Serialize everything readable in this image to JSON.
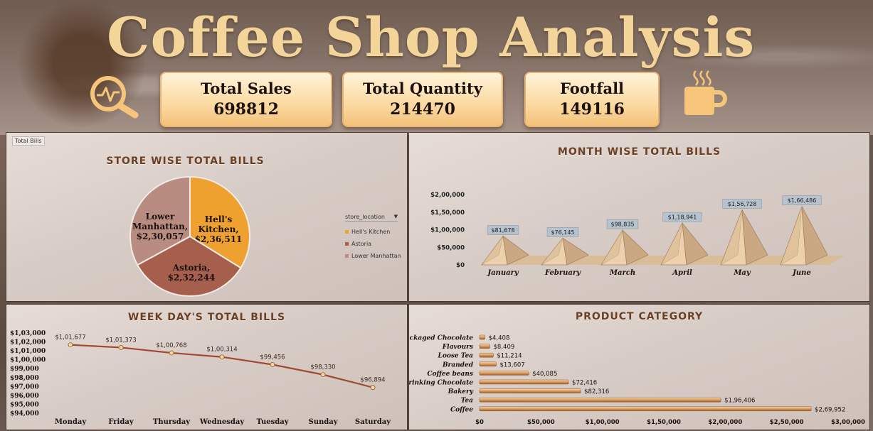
{
  "header": {
    "title": "Coffee Shop Analysis",
    "kpis": [
      {
        "label": "Total Sales",
        "value": "698812"
      },
      {
        "label": "Total Quantity",
        "value": "214470"
      },
      {
        "label": "Footfall",
        "value": "149116"
      }
    ]
  },
  "icons": {
    "left": "analytics-magnifier-icon",
    "right": "coffee-cup-icon"
  },
  "colors": {
    "title": "#f3d59a",
    "hells_kitchen": "#eea12f",
    "astoria": "#a65f4d",
    "lower_manhattan": "#b88c80",
    "accent_text": "#6b3f22",
    "line": "#a04a32"
  },
  "store_panel": {
    "chip": "Total Bills",
    "filter_label": "store_location"
  },
  "month_panel": {
    "title": "MONTH WISE TOTAL BILLS"
  },
  "week_panel": {
    "title": "WEEK DAY'S TOTAL BILLS"
  },
  "product_panel": {
    "title": "PRODUCT CATEGORY"
  },
  "chart_data": [
    {
      "type": "pie",
      "title": "STORE WISE TOTAL BILLS",
      "legend_position": "right",
      "slices": [
        {
          "name": "Hell's Kitchen",
          "label_lines": [
            "Hell's",
            "Kitchen,",
            "$2,36,511"
          ],
          "value": 236511,
          "color": "#eea12f"
        },
        {
          "name": "Astoria",
          "label_lines": [
            "Astoria,",
            "$2,32,244"
          ],
          "value": 232244,
          "color": "#a65f4d"
        },
        {
          "name": "Lower Manhattan",
          "label_lines": [
            "Lower",
            "Manhattan,",
            "$2,30,057"
          ],
          "value": 230057,
          "color": "#b88c80"
        }
      ],
      "legend": [
        "Hell's Kitchen",
        "Astoria",
        "Lower Manhattan"
      ]
    },
    {
      "type": "bar",
      "shape": "pyramid",
      "title": "MONTH WISE TOTAL BILLS",
      "categories": [
        "January",
        "February",
        "March",
        "April",
        "May",
        "June"
      ],
      "values": [
        81678,
        76145,
        98835,
        118941,
        156728,
        166486
      ],
      "data_labels": [
        "$81,678",
        "$76,145",
        "$98,835",
        "$1,18,941",
        "$1,56,728",
        "$1,66,486"
      ],
      "yticks": [
        0,
        50000,
        100000,
        150000,
        200000
      ],
      "ytick_labels": [
        "$0",
        "$50,000",
        "$1,00,000",
        "$1,50,000",
        "$2,00,000"
      ],
      "ylim": [
        0,
        200000
      ]
    },
    {
      "type": "line",
      "title": "WEEK DAY'S TOTAL BILLS",
      "categories": [
        "Monday",
        "Friday",
        "Thursday",
        "Wednesday",
        "Tuesday",
        "Sunday",
        "Saturday"
      ],
      "values": [
        101677,
        101373,
        100768,
        100314,
        99456,
        98330,
        96894
      ],
      "data_labels": [
        "$1,01,677",
        "$1,01,373",
        "$1,00,768",
        "$1,00,314",
        "$99,456",
        "$98,330",
        "$96,894"
      ],
      "yticks": [
        94000,
        95000,
        96000,
        97000,
        98000,
        99000,
        100000,
        101000,
        102000,
        103000
      ],
      "ytick_labels": [
        "$94,000",
        "$95,000",
        "$96,000",
        "$97,000",
        "$98,000",
        "$99,000",
        "$1,00,000",
        "$1,01,000",
        "$1,02,000",
        "$1,03,000"
      ],
      "ylim": [
        94000,
        103000
      ]
    },
    {
      "type": "bar",
      "orientation": "horizontal",
      "title": "PRODUCT CATEGORY",
      "categories": [
        "Packaged Chocolate",
        "Flavours",
        "Loose Tea",
        "Branded",
        "Coffee beans",
        "Drinking Chocolate",
        "Bakery",
        "Tea",
        "Coffee"
      ],
      "values": [
        4408,
        8409,
        11214,
        13607,
        40085,
        72416,
        82316,
        196406,
        269952
      ],
      "data_labels": [
        "$4,408",
        "$8,409",
        "$11,214",
        "$13,607",
        "$40,085",
        "$72,416",
        "$82,316",
        "$1,96,406",
        "$2,69,952"
      ],
      "xticks": [
        0,
        50000,
        100000,
        150000,
        200000,
        250000,
        300000
      ],
      "xtick_labels": [
        "$0",
        "$50,000",
        "$1,00,000",
        "$1,50,000",
        "$2,00,000",
        "$2,50,000",
        "$3,00,000"
      ],
      "xlim": [
        0,
        300000
      ]
    }
  ]
}
